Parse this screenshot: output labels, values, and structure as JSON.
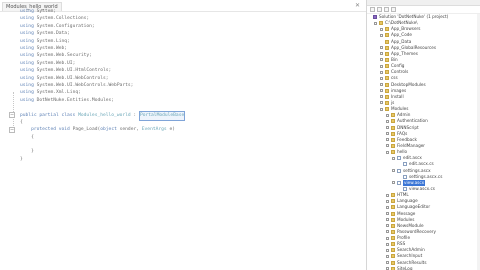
{
  "editor": {
    "active_tab": "Modules_hello_world",
    "nav_left": "",
    "nav_right": "Page_Load(object sender, EventArgs e)",
    "lines": [
      {
        "indent": "",
        "tokens": [
          {
            "t": "using",
            "k": "kw"
          },
          {
            "t": " System;",
            "k": ""
          }
        ]
      },
      {
        "indent": "",
        "tokens": [
          {
            "t": "using",
            "k": "kw"
          },
          {
            "t": " System.Collections;",
            "k": ""
          }
        ]
      },
      {
        "indent": "",
        "tokens": [
          {
            "t": "using",
            "k": "kw"
          },
          {
            "t": " System.Configuration;",
            "k": ""
          }
        ]
      },
      {
        "indent": "",
        "tokens": [
          {
            "t": "using",
            "k": "kw"
          },
          {
            "t": " System.Data;",
            "k": ""
          }
        ]
      },
      {
        "indent": "",
        "tokens": [
          {
            "t": "using",
            "k": "kw"
          },
          {
            "t": " System.Linq;",
            "k": ""
          }
        ]
      },
      {
        "indent": "",
        "tokens": [
          {
            "t": "using",
            "k": "kw"
          },
          {
            "t": " System.Web;",
            "k": ""
          }
        ]
      },
      {
        "indent": "",
        "tokens": [
          {
            "t": "using",
            "k": "kw"
          },
          {
            "t": " System.Web.Security;",
            "k": ""
          }
        ]
      },
      {
        "indent": "",
        "tokens": [
          {
            "t": "using",
            "k": "kw"
          },
          {
            "t": " System.Web.UI;",
            "k": ""
          }
        ]
      },
      {
        "indent": "",
        "tokens": [
          {
            "t": "using",
            "k": "kw"
          },
          {
            "t": " System.Web.UI.HtmlControls;",
            "k": ""
          }
        ]
      },
      {
        "indent": "",
        "tokens": [
          {
            "t": "using",
            "k": "kw"
          },
          {
            "t": " System.Web.UI.WebControls;",
            "k": ""
          }
        ]
      },
      {
        "indent": "",
        "tokens": [
          {
            "t": "using",
            "k": "kw"
          },
          {
            "t": " System.Web.UI.WebControls.WebParts;",
            "k": ""
          }
        ]
      },
      {
        "indent": "",
        "tokens": [
          {
            "t": "using",
            "k": "kw"
          },
          {
            "t": " System.Xml.Linq;",
            "k": ""
          }
        ]
      },
      {
        "indent": "",
        "tokens": [
          {
            "t": "using",
            "k": "kw"
          },
          {
            "t": " DotNetNuke.Entities.Modules;",
            "k": ""
          }
        ]
      },
      {
        "indent": "",
        "tokens": []
      },
      {
        "indent": "",
        "tokens": [
          {
            "t": "public partial class",
            "k": "kw"
          },
          {
            "t": " Modules_hello_world ",
            "k": "ty"
          },
          {
            "t": ": ",
            "k": ""
          },
          {
            "t": "PortalModuleBase",
            "k": "ty",
            "hl": true
          }
        ]
      },
      {
        "indent": "",
        "tokens": [
          {
            "t": "{",
            "k": ""
          }
        ]
      },
      {
        "indent": "    ",
        "tokens": [
          {
            "t": "protected void",
            "k": "kw"
          },
          {
            "t": " Page_Load(",
            "k": ""
          },
          {
            "t": "object",
            "k": "kw"
          },
          {
            "t": " sender, ",
            "k": ""
          },
          {
            "t": "EventArgs",
            "k": "ty"
          },
          {
            "t": " e)",
            "k": ""
          }
        ]
      },
      {
        "indent": "    ",
        "tokens": [
          {
            "t": "{",
            "k": ""
          }
        ]
      },
      {
        "indent": "",
        "tokens": []
      },
      {
        "indent": "    ",
        "tokens": [
          {
            "t": "}",
            "k": ""
          }
        ]
      },
      {
        "indent": "",
        "tokens": [
          {
            "t": "}",
            "k": ""
          }
        ]
      }
    ]
  },
  "explorer": {
    "header": "Solution Explorer",
    "items": [
      {
        "label": "Solution 'DotNetNuke' (1 project)",
        "level": 0,
        "icon": "sol",
        "exp": false
      },
      {
        "label": "C:\\DotNetNuke\\",
        "level": 1,
        "icon": "folder",
        "exp": true
      },
      {
        "label": "App_Browsers",
        "level": 2,
        "icon": "folder",
        "exp": true
      },
      {
        "label": "App_Code",
        "level": 2,
        "icon": "folder",
        "exp": true
      },
      {
        "label": "App_Data",
        "level": 2,
        "icon": "folder",
        "exp": false
      },
      {
        "label": "App_GlobalResources",
        "level": 2,
        "icon": "folder",
        "exp": true
      },
      {
        "label": "App_Themes",
        "level": 2,
        "icon": "folder",
        "exp": true
      },
      {
        "label": "Bin",
        "level": 2,
        "icon": "folder",
        "exp": true
      },
      {
        "label": "Config",
        "level": 2,
        "icon": "folder",
        "exp": true
      },
      {
        "label": "Controls",
        "level": 2,
        "icon": "folder",
        "exp": true
      },
      {
        "label": "css",
        "level": 2,
        "icon": "folder",
        "exp": true
      },
      {
        "label": "DesktopModules",
        "level": 2,
        "icon": "folder",
        "exp": true
      },
      {
        "label": "images",
        "level": 2,
        "icon": "folder",
        "exp": true
      },
      {
        "label": "Install",
        "level": 2,
        "icon": "folder",
        "exp": true
      },
      {
        "label": "js",
        "level": 2,
        "icon": "folder",
        "exp": true
      },
      {
        "label": "Modules",
        "level": 2,
        "icon": "folder",
        "exp": true
      },
      {
        "label": "Admin",
        "level": 3,
        "icon": "folder",
        "exp": true
      },
      {
        "label": "Authentication",
        "level": 3,
        "icon": "folder",
        "exp": true
      },
      {
        "label": "DNNScript",
        "level": 3,
        "icon": "folder",
        "exp": true
      },
      {
        "label": "FAQs",
        "level": 3,
        "icon": "folder",
        "exp": true
      },
      {
        "label": "Feedback",
        "level": 3,
        "icon": "folder",
        "exp": true
      },
      {
        "label": "FieldManager",
        "level": 3,
        "icon": "folder",
        "exp": true
      },
      {
        "label": "hello",
        "level": 3,
        "icon": "folder",
        "exp": true
      },
      {
        "label": "edit.ascx",
        "level": 4,
        "icon": "file",
        "exp": true
      },
      {
        "label": "edit.ascx.cs",
        "level": 5,
        "icon": "file",
        "exp": false
      },
      {
        "label": "settings.ascx",
        "level": 4,
        "icon": "file",
        "exp": true
      },
      {
        "label": "settings.ascx.cs",
        "level": 5,
        "icon": "file",
        "exp": false
      },
      {
        "label": "view.ascx",
        "level": 4,
        "icon": "file",
        "exp": true,
        "selected": true
      },
      {
        "label": "view.ascx.cs",
        "level": 5,
        "icon": "file",
        "exp": false
      },
      {
        "label": "HTML",
        "level": 3,
        "icon": "folder",
        "exp": true
      },
      {
        "label": "Language",
        "level": 3,
        "icon": "folder",
        "exp": true
      },
      {
        "label": "LanguageEditor",
        "level": 3,
        "icon": "folder",
        "exp": true
      },
      {
        "label": "Message",
        "level": 3,
        "icon": "folder",
        "exp": true
      },
      {
        "label": "Modules",
        "level": 3,
        "icon": "folder",
        "exp": true
      },
      {
        "label": "NewsModule",
        "level": 3,
        "icon": "folder",
        "exp": true
      },
      {
        "label": "PasswordRecovery",
        "level": 3,
        "icon": "folder",
        "exp": true
      },
      {
        "label": "Profile",
        "level": 3,
        "icon": "folder",
        "exp": true
      },
      {
        "label": "RSS",
        "level": 3,
        "icon": "folder",
        "exp": true
      },
      {
        "label": "SearchAdmin",
        "level": 3,
        "icon": "folder",
        "exp": true
      },
      {
        "label": "SearchInput",
        "level": 3,
        "icon": "folder",
        "exp": true
      },
      {
        "label": "SearchResults",
        "level": 3,
        "icon": "folder",
        "exp": true
      },
      {
        "label": "SiteLog",
        "level": 3,
        "icon": "folder",
        "exp": true
      },
      {
        "label": "Skins",
        "level": 3,
        "icon": "folder",
        "exp": true
      }
    ]
  }
}
